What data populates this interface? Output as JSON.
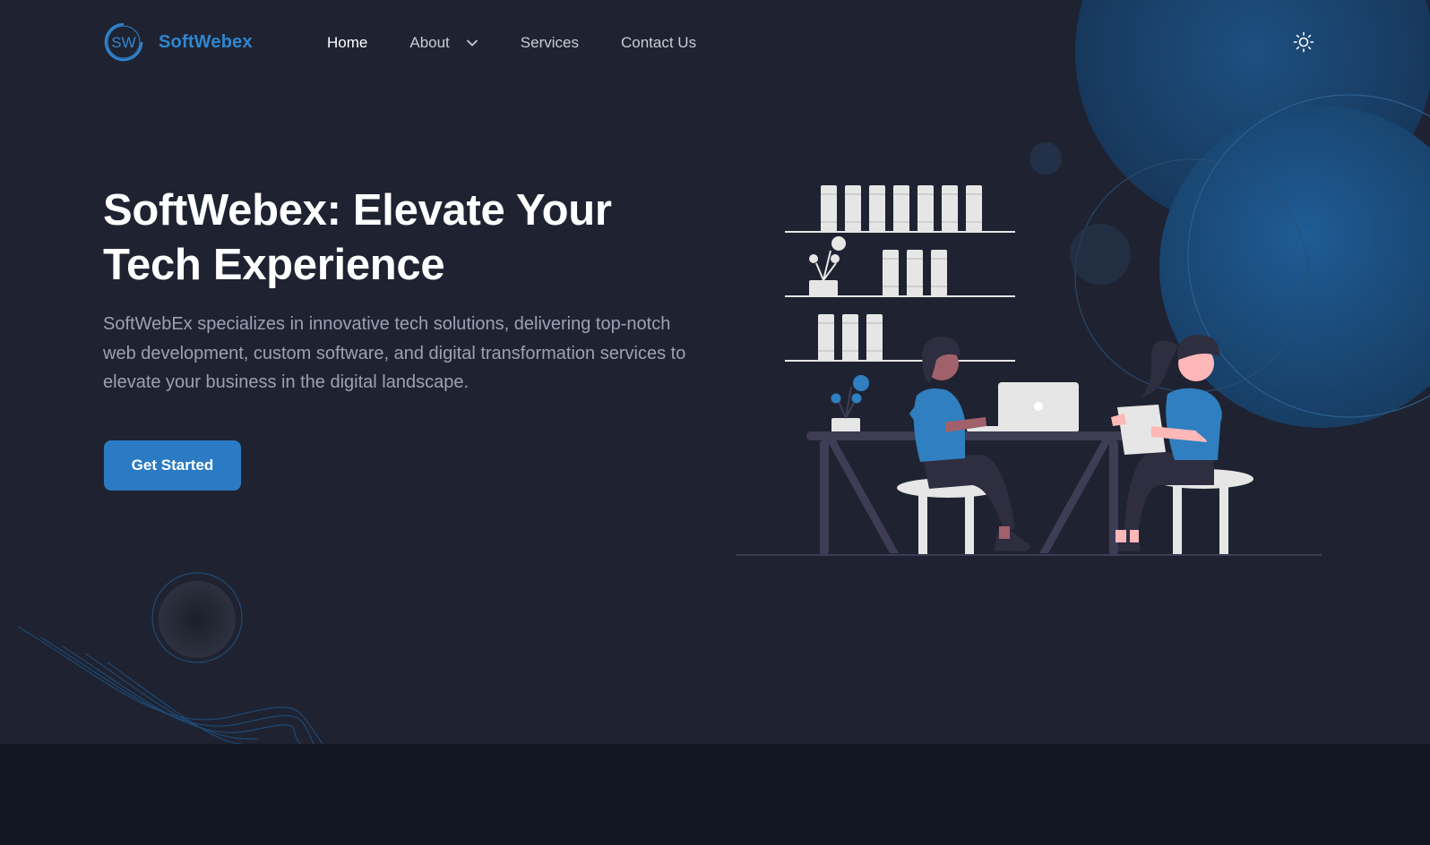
{
  "brand": {
    "logo_initials": "SW",
    "name": "SoftWebex",
    "accent_color": "#2f86d0"
  },
  "nav": {
    "items": [
      {
        "label": "Home",
        "active": true
      },
      {
        "label": "About",
        "has_dropdown": true
      },
      {
        "label": "Services"
      },
      {
        "label": "Contact Us"
      }
    ],
    "theme_toggle_icon": "sun-icon"
  },
  "hero": {
    "title_line1": "SoftWebex: Elevate Your",
    "title_line2": "Tech Experience",
    "description": "SoftWebEx specializes in innovative tech solutions, delivering top-notch web development, custom software, and digital transformation services to elevate your business in the digital landscape.",
    "cta_label": "Get Started",
    "cta_color": "#2a7bc3"
  },
  "colors": {
    "hero_background": "#1f2331",
    "footer_band": "#131722",
    "illustration_blue": "#2f7fc1",
    "illustration_dark": "#3f3d56"
  }
}
